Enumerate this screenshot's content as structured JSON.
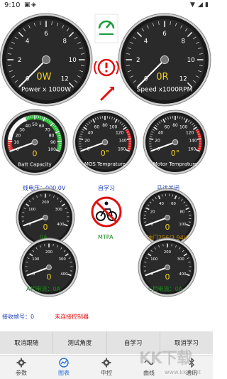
{
  "status": {
    "time": "9:10"
  },
  "gauges": {
    "power": {
      "value": "0W",
      "label": "Power x 1000W",
      "ticks": [
        "0",
        "2",
        "4",
        "6",
        "8",
        "10",
        "12"
      ]
    },
    "speed": {
      "value": "0R",
      "label": "Speed x1000RPM",
      "ticks": [
        "0",
        "2",
        "4",
        "6",
        "8",
        "10",
        "12"
      ]
    },
    "battery": {
      "value": "0",
      "label": "Batt Capacity",
      "ticks": [
        "0",
        "10",
        "20",
        "30",
        "40",
        "50",
        "60",
        "70",
        "80",
        "90",
        "100"
      ]
    },
    "mos_temp": {
      "value": "0°",
      "label": "MOS Temprature",
      "ticks": [
        "0",
        "20",
        "40",
        "60",
        "80",
        "100",
        "120",
        "140",
        "160"
      ]
    },
    "motor_temp": {
      "value": "0°",
      "label": "Motor Temprature",
      "ticks": [
        "0",
        "20",
        "40",
        "60",
        "80",
        "100",
        "120",
        "140",
        "160"
      ]
    },
    "current": {
      "value": "0",
      "ticks": [
        "0",
        "100",
        "200",
        "300",
        "400"
      ]
    },
    "throttle": {
      "value": "0",
      "ticks": [
        "0",
        "20",
        "40",
        "60",
        "80",
        "100"
      ]
    },
    "phase_a": {
      "value": "0",
      "ticks": [
        "0",
        "100",
        "200",
        "300",
        "400"
      ]
    },
    "phase_c": {
      "value": "0",
      "ticks": [
        "0",
        "100",
        "200",
        "300",
        "400"
      ]
    }
  },
  "labels": {
    "voltage": "线电压：000.0V",
    "self_learn": "自学习",
    "motor_off": "马达关闭",
    "current_val": "0A",
    "mtpa": "MTPA",
    "throttle_val": "油门256/3.94V",
    "phase_a": "A相电流：0A",
    "phase_c": "C相电流：0A",
    "frame_no": "接收帧号：0",
    "connection": "未连接控制器"
  },
  "buttons": [
    "取消跟随",
    "测试角度",
    "自学习",
    "取消学习"
  ],
  "nav": [
    {
      "label": "参数",
      "icon": "gear-icon"
    },
    {
      "label": "图表",
      "icon": "chart-icon"
    },
    {
      "label": "中控",
      "icon": "gear-icon"
    },
    {
      "label": "曲线",
      "icon": "wave-icon"
    },
    {
      "label": "通讯",
      "icon": "bluetooth-icon"
    }
  ],
  "watermark": {
    "logo": "KK下载",
    "url": "www.kkx.net"
  },
  "colors": {
    "blue": "#1e3fc0",
    "green": "#1a8a1a",
    "orange": "#c98b00",
    "red": "#e01010",
    "gauge_value": "#f2d21a"
  }
}
